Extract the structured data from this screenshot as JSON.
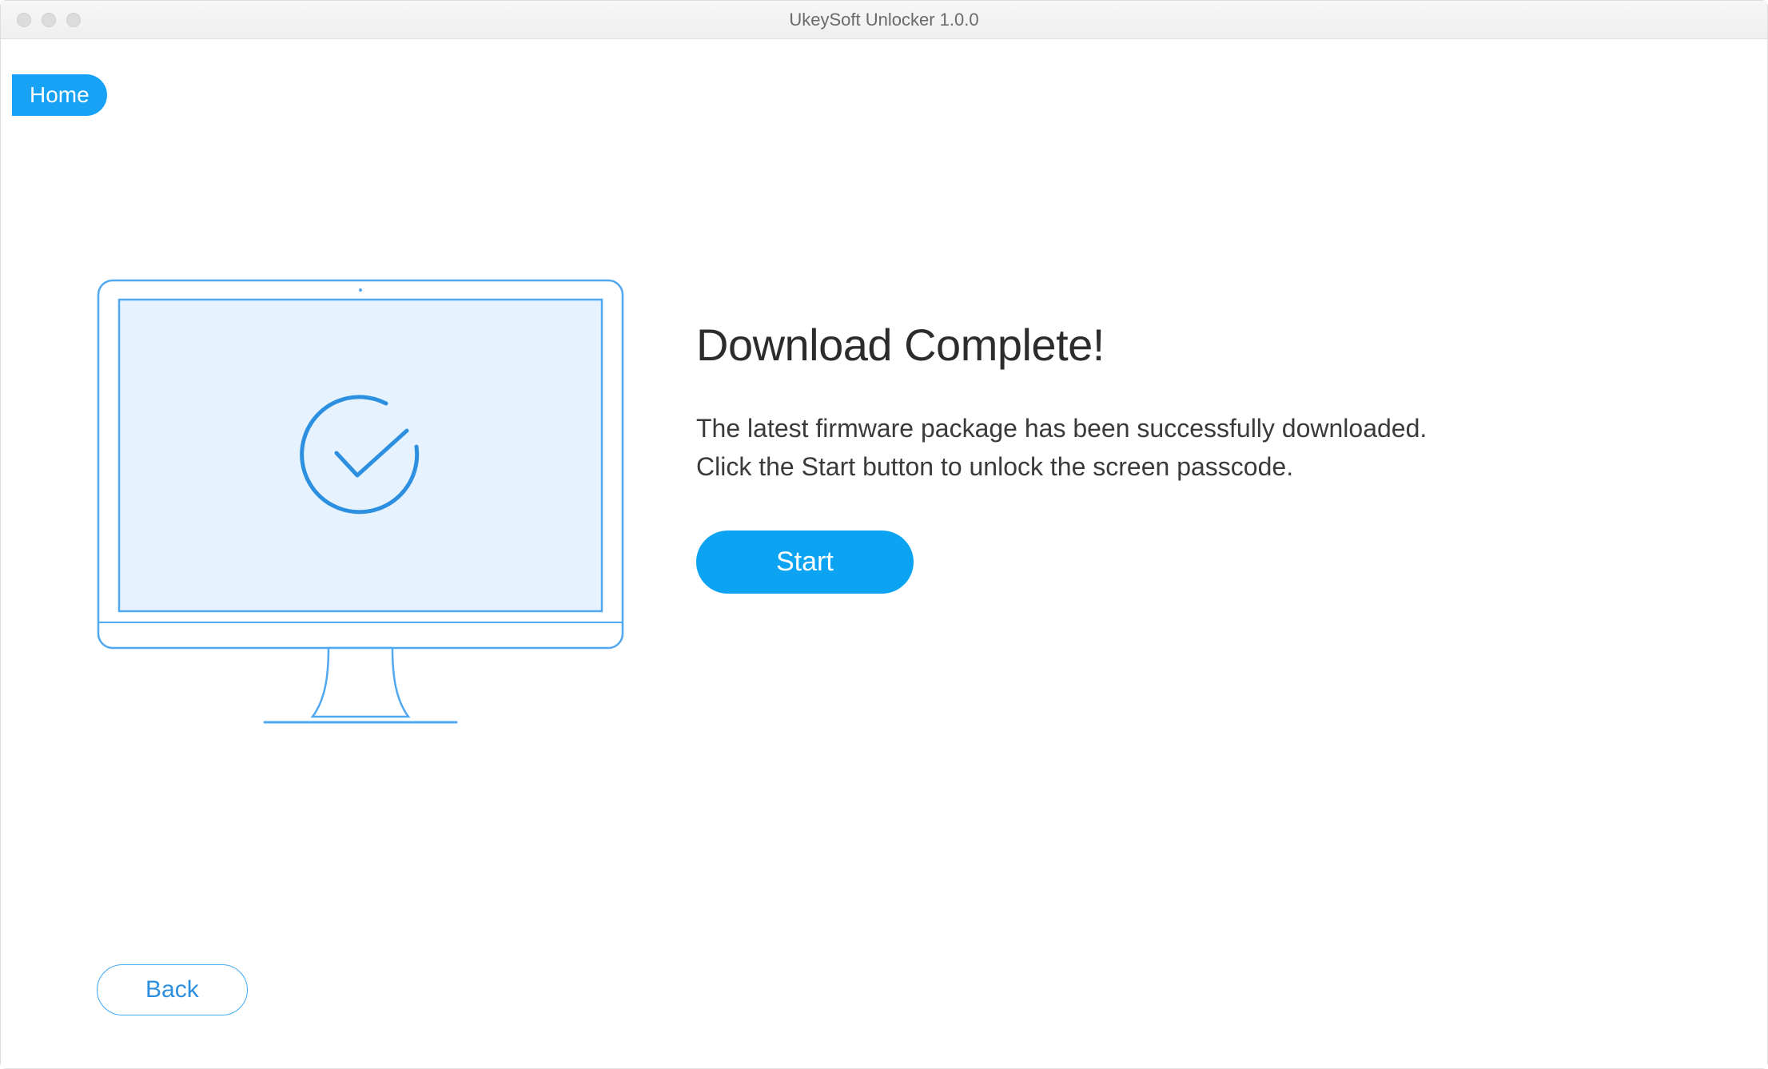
{
  "window": {
    "title": "UkeySoft Unlocker 1.0.0"
  },
  "nav": {
    "home_label": "Home"
  },
  "main": {
    "heading": "Download Complete!",
    "description_line1": "The latest firmware package has been successfully downloaded.",
    "description_line2": "Click the Start button to unlock the screen passcode.",
    "start_label": "Start"
  },
  "footer": {
    "back_label": "Back"
  },
  "colors": {
    "accent": "#17a2f5",
    "accent_dark": "#0da3f3",
    "outline_blue": "#3fa9f5",
    "illustration_fill": "#e6f3ff",
    "illustration_stroke": "#4fa8f0",
    "text_dark": "#2c2c2c"
  }
}
